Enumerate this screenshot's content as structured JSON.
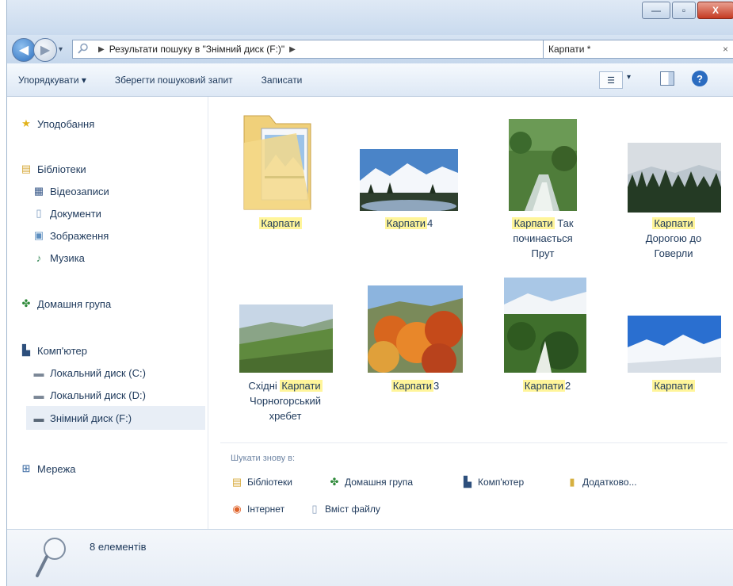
{
  "window": {
    "controls": {
      "minimize": "—",
      "maximize": "▫",
      "close": "X"
    }
  },
  "nav": {
    "back_icon": "arrow-left-icon",
    "forward_icon": "arrow-right-icon",
    "address_parts": [
      "Результати пошуку в \"Знімний диск (F:)\""
    ],
    "search_value": "Карпати *"
  },
  "toolbar": {
    "organize": "Упорядкувати ▾",
    "save_search": "Зберегти пошуковий запит",
    "burn": "Записати",
    "help": "?"
  },
  "sidebar": {
    "favorites": "Уподобання",
    "libraries": "Бібліотеки",
    "videos": "Відеозаписи",
    "documents": "Документи",
    "pictures": "Зображення",
    "music": "Музика",
    "homegroup": "Домашня група",
    "computer": "Комп'ютер",
    "disk_c": "Локальний диск (C:)",
    "disk_d": "Локальний диск (D:)",
    "disk_f": "Знімний диск (F:)",
    "network": "Мережа"
  },
  "items": [
    {
      "hl": "Карпати",
      "rest": "",
      "line2": "",
      "line3": ""
    },
    {
      "hl": "Карпати",
      "rest": "4",
      "line2": "",
      "line3": ""
    },
    {
      "hl": "Карпати",
      "rest": " Так",
      "line2": "починається",
      "line3": "Прут"
    },
    {
      "hl": "Карпати",
      "rest": "",
      "line2": "Дорогою до",
      "line3": "Говерли"
    },
    {
      "pre": "Східні ",
      "hl": "Карпати",
      "rest": "",
      "line2": "Чорногорський",
      "line3": "хребет"
    },
    {
      "hl": "Карпати",
      "rest": "3",
      "line2": "",
      "line3": ""
    },
    {
      "hl": "Карпати",
      "rest": "2",
      "line2": "",
      "line3": ""
    },
    {
      "hl": "Карпати",
      "rest": "",
      "line2": "",
      "line3": ""
    }
  ],
  "search_again": {
    "title": "Шукати знову в:",
    "libraries": "Бібліотеки",
    "homegroup": "Домашня група",
    "computer": "Комп'ютер",
    "custom": "Додатково...",
    "internet": "Інтернет",
    "file_contents": "Вміст файлу"
  },
  "status": {
    "count": "8 елементів"
  }
}
